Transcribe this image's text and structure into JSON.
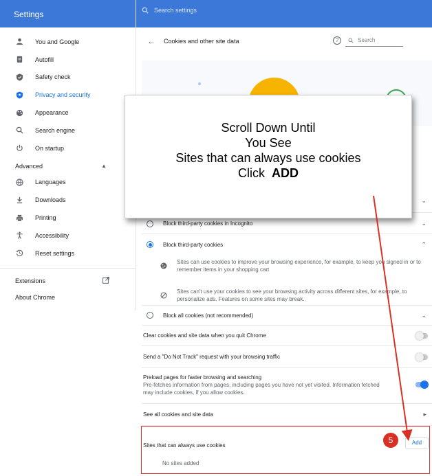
{
  "sidebar": {
    "title": "Settings",
    "items": [
      {
        "label": "You and Google",
        "icon": "person-icon"
      },
      {
        "label": "Autofill",
        "icon": "clipboard-icon"
      },
      {
        "label": "Safety check",
        "icon": "shield-check-icon"
      },
      {
        "label": "Privacy and security",
        "icon": "shield-icon"
      },
      {
        "label": "Appearance",
        "icon": "palette-icon"
      },
      {
        "label": "Search engine",
        "icon": "search-icon"
      },
      {
        "label": "On startup",
        "icon": "power-icon"
      }
    ],
    "advanced_label": "Advanced",
    "advanced_items": [
      {
        "label": "Languages",
        "icon": "globe-icon"
      },
      {
        "label": "Downloads",
        "icon": "download-icon"
      },
      {
        "label": "Printing",
        "icon": "printer-icon"
      },
      {
        "label": "Accessibility",
        "icon": "accessibility-icon"
      },
      {
        "label": "Reset settings",
        "icon": "history-icon"
      }
    ],
    "extensions_label": "Extensions",
    "about_label": "About Chrome"
  },
  "topbar": {
    "search_placeholder": "Search settings"
  },
  "page": {
    "title": "Cookies and other site data",
    "search_placeholder": "Search"
  },
  "rows": {
    "block_incognito": "Block third-party cookies in Incognito",
    "block_third_party": "Block third-party cookies",
    "allow_desc": "Sites can use cookies to improve your browsing experience, for example, to keep you signed in or to remember items in your shopping cart",
    "block_desc": "Sites can't use your cookies to see your browsing activity across different sites, for example, to personalize ads. Features on some sites may break.",
    "block_all": "Block all cookies (not recommended)",
    "clear_on_quit": "Clear cookies and site data when you quit Chrome",
    "do_not_track": "Send a \"Do Not Track\" request with your browsing traffic",
    "preload_title": "Preload pages for faster browsing and searching",
    "preload_desc": "Pre-fetches information from pages, including pages you have not yet visited. Information fetched may include cookies, if you allow cookies.",
    "see_all": "See all cookies and site data",
    "sites_always": "Sites that can always use cookies",
    "add_button": "Add",
    "no_sites": "No sites added"
  },
  "callout": {
    "line1": "Scroll Down Until",
    "line2": "You See",
    "line3": "Sites that can always use cookies",
    "line4_prefix": "Click",
    "line4_strong": "ADD"
  },
  "step_number": "5",
  "colors": {
    "header_blue": "#3c78d8",
    "accent": "#1a73e8",
    "annotation_red": "#d93025"
  }
}
